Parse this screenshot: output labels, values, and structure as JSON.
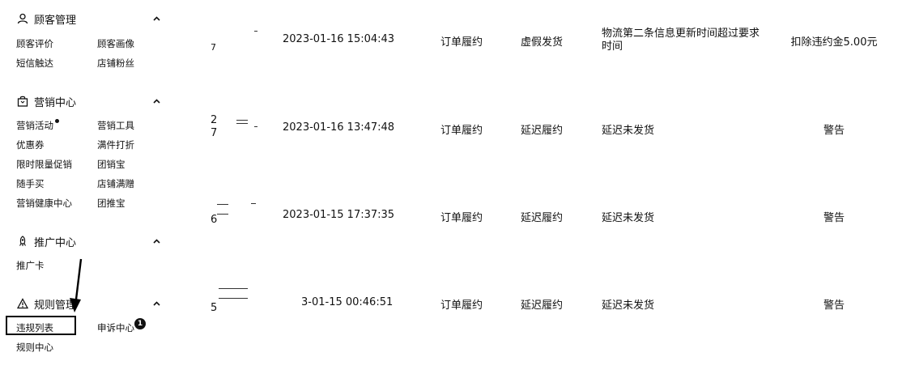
{
  "sidebar": {
    "sections": [
      {
        "title": "顾客管理",
        "items": [
          "顾客评价",
          "顾客画像",
          "短信触达",
          "店铺粉丝"
        ]
      },
      {
        "title": "营销中心",
        "items": [
          "营销活动",
          "营销工具",
          "优惠券",
          "满件打折",
          "限时限量促销",
          "团销宝",
          "随手买",
          "店铺满赠",
          "营销健康中心",
          "团推宝"
        ]
      },
      {
        "title": "推广中心",
        "items": [
          "推广卡"
        ]
      },
      {
        "title": "规则管理",
        "items": [
          "违规列表",
          "申诉中心",
          "规则中心"
        ],
        "badge": "1"
      }
    ]
  },
  "table": {
    "rows": [
      {
        "id_fragment": "7",
        "time": "2023-01-16 15:04:43",
        "category": "订单履约",
        "type": "虚假发货",
        "reason": "物流第二条信息更新时间超过要求时间",
        "penalty": "扣除违约金5.00元"
      },
      {
        "id_fragment": "2",
        "id_fragment_2": "7",
        "time": "2023-01-16 13:47:48",
        "category": "订单履约",
        "type": "延迟履约",
        "reason": "延迟未发货",
        "penalty": "警告"
      },
      {
        "id_fragment": "6",
        "time": "2023-01-15 17:37:35",
        "category": "订单履约",
        "type": "延迟履约",
        "reason": "延迟未发货",
        "penalty": "警告"
      },
      {
        "id_fragment": "5",
        "time": "3-01-15 00:46:51",
        "category": "订单履约",
        "type": "延迟履约",
        "reason": "延迟未发货",
        "penalty": "警告"
      }
    ]
  },
  "colors": {
    "text": "#111111",
    "background": "#ffffff",
    "annotation": "#000000"
  }
}
